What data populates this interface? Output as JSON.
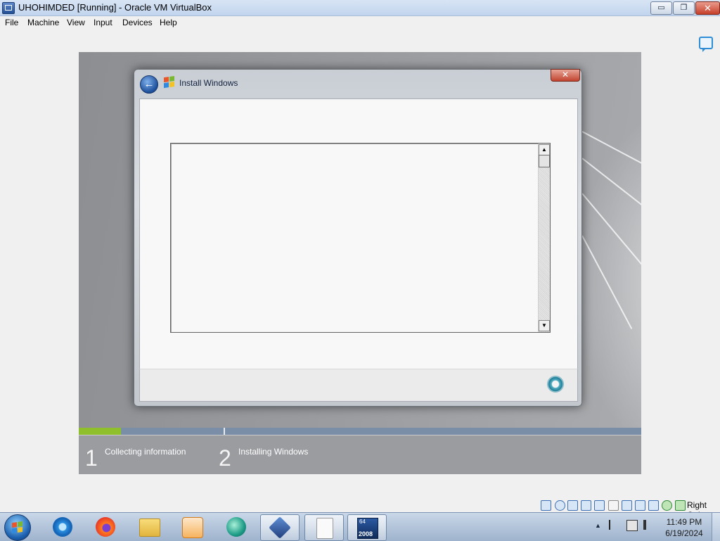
{
  "window": {
    "title": "UHOHIMDED [Running] - Oracle VM VirtualBox",
    "minimize_glyph": "▭",
    "maximize_glyph": "❐",
    "close_glyph": "✕"
  },
  "menu": [
    "File",
    "Machine",
    "View",
    "Input",
    "Devices",
    "Help"
  ],
  "vm_screen": {
    "dialog": {
      "title": "Install Windows",
      "back_glyph": "←",
      "close_glyph": "✕",
      "scroll_up": "▲",
      "scroll_down": "▼",
      "busy_icon": "spinner-icon"
    },
    "progress_fraction": 0.075,
    "steps": [
      {
        "number": "1",
        "label": "Collecting information"
      },
      {
        "number": "2",
        "label": "Installing Windows"
      }
    ]
  },
  "statusbar": {
    "icons": [
      "hard-disk-icon",
      "optical-drive-icon",
      "audio-icon",
      "network-icon",
      "usb-icon",
      "shared-folders-icon",
      "display-icon",
      "recording-icon",
      "cpu-icon",
      "guest-additions-icon",
      "mouse-integration-icon"
    ],
    "host_key": "Right Ctrl"
  },
  "taskbar": {
    "apps": [
      "internet-explorer-icon",
      "firefox-icon",
      "file-explorer-icon",
      "media-player-icon",
      "chat-app-icon",
      "virtualbox-icon",
      "disc-image-icon",
      "windows-server-2008-icon"
    ],
    "app_badge": {
      "top": "64",
      "bottom": "2008"
    },
    "clock_time": "11:49 PM",
    "clock_date": "6/19/2024"
  },
  "colors": {
    "progress_done": "#8fbf2a",
    "progress_bg": "#7b8ea8",
    "close_red": "#c6402a"
  }
}
